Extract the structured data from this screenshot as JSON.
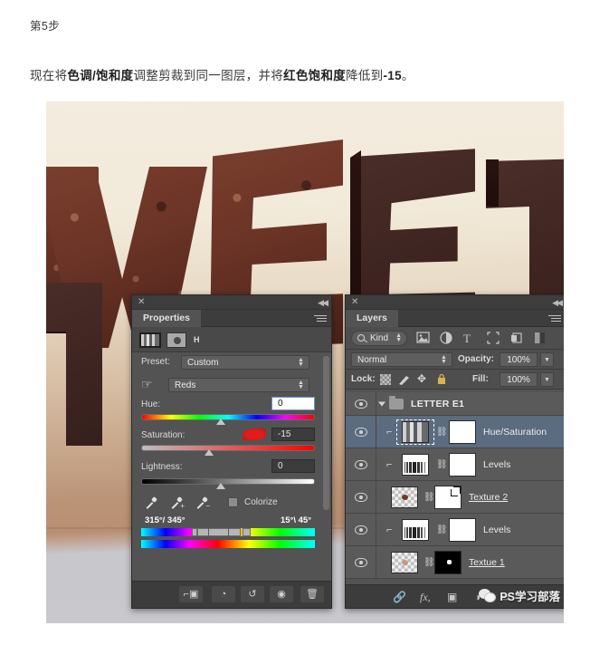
{
  "article": {
    "step_label": "第5步",
    "paragraph_prefix": "现在将",
    "paragraph_bold1": "色调/饱和度",
    "paragraph_mid1": "调整剪裁到同一图层，并将",
    "paragraph_bold2": "红色饱和度",
    "paragraph_mid2": "降低到",
    "paragraph_bold3": "-15",
    "paragraph_suffix": "。"
  },
  "properties_panel": {
    "close_label": "✕",
    "collapse_label": "◀◀",
    "tab_label": "Properties",
    "channel_label": "H",
    "preset_label": "Preset:",
    "preset_value": "Custom",
    "range_value": "Reds",
    "hue_label": "Hue:",
    "hue_value": "0",
    "saturation_label": "Saturation:",
    "saturation_value": "-15",
    "lightness_label": "Lightness:",
    "lightness_value": "0",
    "colorize_label": "Colorize",
    "range_left_label": "315°/ 345°",
    "range_right_label": "15°\\ 45°",
    "footer_buttons": [
      {
        "name": "clip-to-layer",
        "glyph": "⊐"
      },
      {
        "name": "previous-state",
        "glyph": "◔"
      },
      {
        "name": "reset",
        "glyph": "↺"
      },
      {
        "name": "toggle-visibility",
        "glyph": "◉"
      },
      {
        "name": "delete",
        "glyph": "🗑"
      }
    ]
  },
  "layers_panel": {
    "close_label": "✕",
    "collapse_label": "◀◀",
    "tab_label": "Layers",
    "filter_kind": "Kind",
    "filter_icons": [
      "pixel-filter",
      "adjustment-filter",
      "type-filter",
      "shape-filter",
      "smart-object-filter",
      "mask-filter"
    ],
    "blend_mode": "Normal",
    "opacity_label": "Opacity:",
    "opacity_value": "100%",
    "lock_label": "Lock:",
    "fill_label": "Fill:",
    "fill_value": "100%",
    "rows": [
      {
        "type": "group",
        "name": "LETTER E1",
        "underline": false
      },
      {
        "type": "adjust",
        "name": "Hue/Saturation",
        "underline": false,
        "selected": true
      },
      {
        "type": "levels",
        "name": "Levels",
        "underline": false
      },
      {
        "type": "smart",
        "name": "Texture 2",
        "underline": true
      },
      {
        "type": "levels",
        "name": "Levels",
        "underline": false
      },
      {
        "type": "smart",
        "name": "Textue 1",
        "underline": true
      }
    ],
    "footer_buttons": [
      {
        "name": "link-layers",
        "glyph": "🔗"
      },
      {
        "name": "layer-style",
        "glyph": "fx"
      },
      {
        "name": "add-mask",
        "glyph": "▣"
      },
      {
        "name": "new-adjustment-layer",
        "glyph": "◑"
      },
      {
        "name": "new-group",
        "glyph": "▭"
      }
    ]
  },
  "watermark": {
    "text": "PS学习部落",
    "icon": "wechat-icon"
  },
  "colors": {
    "panel_bg": "#535353",
    "panel_header": "#3d3d3d",
    "row_selected": "#5b6b80",
    "accent_red": "#e21b1b"
  }
}
